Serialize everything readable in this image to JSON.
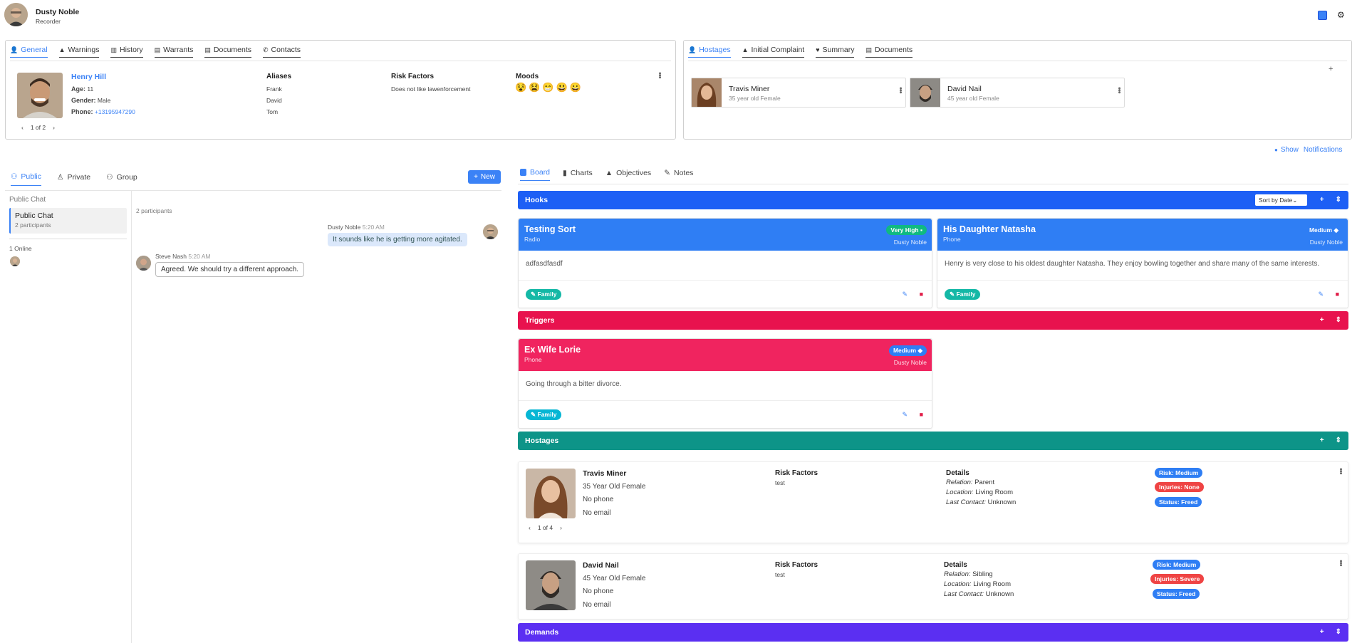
{
  "header": {
    "user_name": "Dusty Noble",
    "user_role": "Recorder"
  },
  "subject_panel": {
    "tabs": [
      "General",
      "Warnings",
      "History",
      "Warrants",
      "Documents",
      "Contacts"
    ],
    "name": "Henry Hill",
    "age_label": "Age:",
    "age": "11",
    "gender_label": "Gender:",
    "gender": "Male",
    "phone_label": "Phone:",
    "phone": "+13195947290",
    "pager": "1 of 2",
    "aliases_title": "Aliases",
    "aliases": [
      "Frank",
      "David",
      "Tom"
    ],
    "risk_title": "Risk Factors",
    "risk_text": "Does not like lawenforcement",
    "moods_title": "Moods",
    "moods": [
      "😵",
      "😫",
      "😁",
      "😃",
      "😀"
    ]
  },
  "hostages_panel": {
    "tabs": [
      "Hostages",
      "Initial Complaint",
      "Summary",
      "Documents"
    ],
    "add": "+",
    "cards": [
      {
        "name": "Travis Miner",
        "sub": "35 year old Female"
      },
      {
        "name": "David Nail",
        "sub": "45 year old Female"
      }
    ]
  },
  "notifications": {
    "label": "Show",
    "label2": "Notifications"
  },
  "chat": {
    "tabs": [
      "Public",
      "Private",
      "Group"
    ],
    "new_button": "New",
    "list_title": "Public Chat",
    "room_name": "Public Chat",
    "room_participants": "2 participants",
    "online": "1 Online",
    "participants_header": "2 participants",
    "messages": [
      {
        "author": "Dusty Noble",
        "time": "5:20 AM",
        "text": "It sounds like he is getting more agitated."
      },
      {
        "author": "Steve Nash",
        "time": "5:20 AM",
        "text": "Agreed. We should try a different approach."
      }
    ]
  },
  "board": {
    "tabs": [
      "Board",
      "Charts",
      "Objectives",
      "Notes"
    ],
    "sort_label": "Sort by Date",
    "sections": {
      "hooks": "Hooks",
      "triggers": "Triggers",
      "hostages": "Hostages",
      "demands": "Demands"
    },
    "hooks": [
      {
        "title": "Testing Sort",
        "sub": "Radio",
        "badge": "Very High",
        "owner": "Dusty Noble",
        "body": "adfasdfasdf",
        "tag": "Family"
      },
      {
        "title": "His Daughter Natasha",
        "sub": "Phone",
        "badge": "Medium",
        "owner": "Dusty Noble",
        "body": "Henry is very close to his oldest daughter Natasha. They enjoy bowling together and share many of the same interests.",
        "tag": "Family"
      }
    ],
    "triggers": [
      {
        "title": "Ex Wife Lorie",
        "sub": "Phone",
        "badge": "Medium",
        "owner": "Dusty Noble",
        "body": "Going through a bitter divorce.",
        "tag": "Family"
      }
    ],
    "hostages": [
      {
        "name": "Travis Miner",
        "desc": "35 Year Old Female",
        "phone": "No phone",
        "email": "No email",
        "risk_title": "Risk Factors",
        "risk": "test",
        "details_title": "Details",
        "relation_label": "Relation:",
        "relation": "Parent",
        "location_label": "Location:",
        "location": "Living Room",
        "contact_label": "Last Contact:",
        "contact": "Unknown",
        "risk_pill": "Risk: Medium",
        "injury_pill": "Injuries: None",
        "status_pill": "Status: Freed",
        "pager": "1 of 4"
      },
      {
        "name": "David Nail",
        "desc": "45 Year Old Female",
        "phone": "No phone",
        "email": "No email",
        "risk_title": "Risk Factors",
        "risk": "test",
        "details_title": "Details",
        "relation_label": "Relation:",
        "relation": "Sibling",
        "location_label": "Location:",
        "location": "Living Room",
        "contact_label": "Last Contact:",
        "contact": "Unknown",
        "risk_pill": "Risk: Medium",
        "injury_pill": "Injuries: Severe",
        "status_pill": "Status: Freed"
      }
    ]
  },
  "colors": {
    "accent": "#3b82f6",
    "hooks": "#1d5ff5",
    "triggers": "#e8124e",
    "hostages": "#0d9488",
    "demands": "#5b2ff2"
  }
}
